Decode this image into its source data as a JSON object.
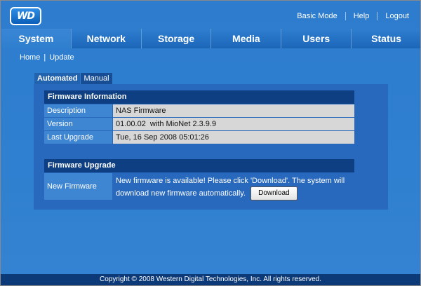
{
  "logo": {
    "text": "WD"
  },
  "top_links": {
    "basic_mode": "Basic Mode",
    "help": "Help",
    "logout": "Logout"
  },
  "tabs": [
    {
      "label": "System",
      "active": true
    },
    {
      "label": "Network"
    },
    {
      "label": "Storage"
    },
    {
      "label": "Media"
    },
    {
      "label": "Users"
    },
    {
      "label": "Status"
    }
  ],
  "breadcrumb": {
    "home": "Home",
    "separator": "|",
    "current": "Update"
  },
  "subtabs": {
    "automated": "Automated",
    "manual": "Manual"
  },
  "firmware_info": {
    "title": "Firmware Information",
    "rows": [
      {
        "label": "Description",
        "value": "NAS Firmware"
      },
      {
        "label": "Version",
        "value": "01.00.02  with MioNet 2.3.9.9"
      },
      {
        "label": "Last Upgrade",
        "value": "Tue, 16 Sep 2008 05:01:26"
      }
    ]
  },
  "firmware_upgrade": {
    "title": "Firmware Upgrade",
    "label": "New Firmware",
    "message": "New firmware is available! Please click 'Download'. The system will download new firmware automatically.",
    "button": "Download"
  },
  "footer": "Copyright © 2008 Western Digital Technologies, Inc. All rights reserved.",
  "colors": {
    "background": "#2f7fcf",
    "header_bar": "#0d3f82",
    "value_cell": "#d7d7d7"
  }
}
